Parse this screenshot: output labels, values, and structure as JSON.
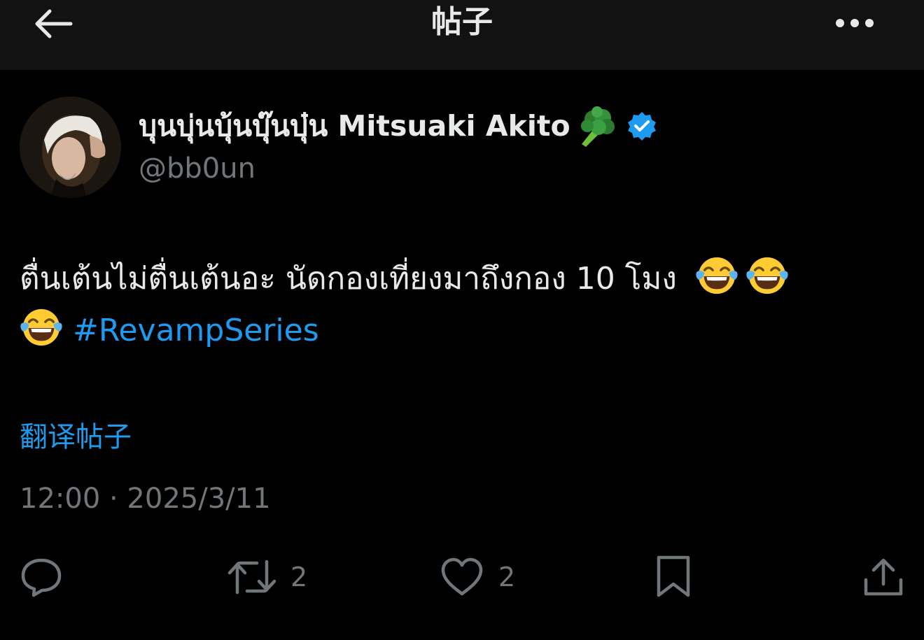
{
  "header": {
    "title": "帖子",
    "back_icon": "arrow-left-icon",
    "more_icon": "more-horizontal-icon"
  },
  "author": {
    "display_name": "บุนบุ่นบุ้นบุ๊นบุ๋น Mitsuaki Akito",
    "name_emoji": "broccoli-icon",
    "verified_icon": "verified-badge-icon",
    "handle": "@bb0un"
  },
  "post": {
    "text_line1": "ตื่นเต้นไม่ตื่นเต้นอะ นัดกองเที่ยงมาถึงกอง 10 โมง",
    "emoji": "face-with-tears-of-joy-icon",
    "hashtag": "#RevampSeries",
    "translate_label": "翻译帖子",
    "timestamp": "12:00 · 2025/3/11"
  },
  "actions": {
    "reply_icon": "reply-icon",
    "retweet_icon": "retweet-icon",
    "retweet_count": "2",
    "like_icon": "heart-icon",
    "like_count": "2",
    "bookmark_icon": "bookmark-icon",
    "share_icon": "share-icon"
  },
  "colors": {
    "background": "#000000",
    "header_background": "#121212",
    "text": "#e7e9ea",
    "secondary_text": "#71767b",
    "accent": "#1d9bf0"
  }
}
